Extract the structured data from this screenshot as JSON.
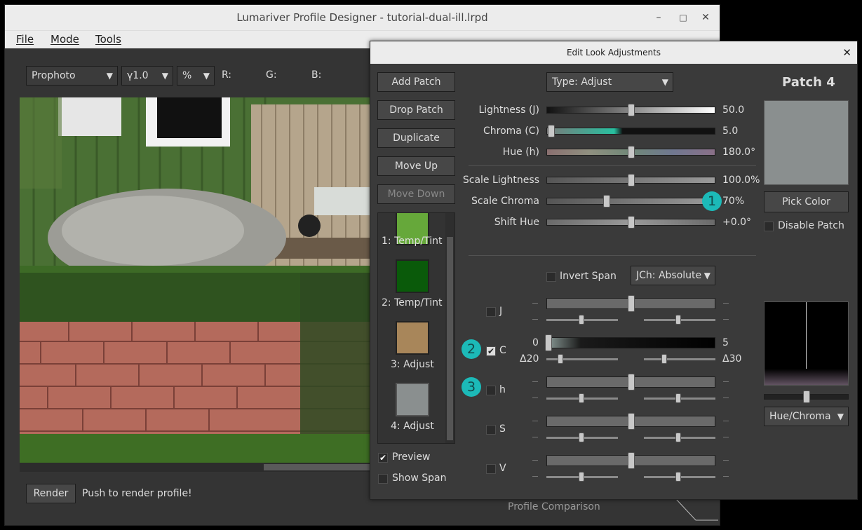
{
  "main_window": {
    "title": "Lumariver Profile Designer - tutorial-dual-ill.lrpd",
    "window_controls": {
      "minimize": "–",
      "maximize": "□",
      "close": "✕"
    },
    "menu": [
      "File",
      "Mode",
      "Tools"
    ],
    "toolbar": {
      "colorspace": "Prophoto",
      "gamma": "γ1.0",
      "unit": "%",
      "r_label": "R:",
      "g_label": "G:",
      "b_label": "B:"
    },
    "render_button": "Render",
    "render_hint": "Push to render profile!",
    "bottom_tab": "Profile Comparison"
  },
  "dialog": {
    "title": "Edit Look Adjustments",
    "close": "✕",
    "buttons": {
      "add_patch": "Add Patch",
      "drop_patch": "Drop Patch",
      "duplicate": "Duplicate",
      "move_up": "Move Up",
      "move_down": "Move Down"
    },
    "patches": [
      {
        "label": "1: Temp/Tint",
        "color": "#66a83a"
      },
      {
        "label": "2: Temp/Tint",
        "color": "#0a5a0a"
      },
      {
        "label": "3: Adjust",
        "color": "#a8865a"
      },
      {
        "label": "4: Adjust",
        "color": "#8a8f8f"
      }
    ],
    "preview": {
      "label": "Preview",
      "checked": true
    },
    "show_span": {
      "label": "Show Span",
      "checked": false
    },
    "type_select": "Type: Adjust",
    "sliders": [
      {
        "label": "Lightness (J)",
        "value": "50.0",
        "position": 0.5
      },
      {
        "label": "Chroma (C)",
        "value": "5.0",
        "position": 0.02
      },
      {
        "label": "Hue (h)",
        "value": "180.0°",
        "position": 0.5
      },
      {
        "label": "Scale Lightness",
        "value": "100.0%",
        "position": 0.5
      },
      {
        "label": "Scale Chroma",
        "value": "70%",
        "position": 0.35
      },
      {
        "label": "Shift Hue",
        "value": "+0.0°",
        "position": 0.5
      }
    ],
    "invert_span": {
      "label": "Invert Span",
      "checked": false
    },
    "span_mode": "JCh: Absolute",
    "span_rows": [
      {
        "key": "J",
        "checked": false
      },
      {
        "key": "C",
        "checked": true,
        "min": "0",
        "max": "5",
        "delta_low": "Δ20",
        "delta_high": "Δ30"
      },
      {
        "key": "h",
        "checked": false
      },
      {
        "key": "S",
        "checked": false
      },
      {
        "key": "V",
        "checked": false
      }
    ],
    "dash": "–",
    "badges": [
      "1",
      "2",
      "3"
    ],
    "patch_title": "Patch 4",
    "patch_color": "#8a8f8f",
    "pick_color": "Pick Color",
    "disable_patch": {
      "label": "Disable Patch",
      "checked": false
    },
    "plot_select": "Hue/Chroma"
  }
}
